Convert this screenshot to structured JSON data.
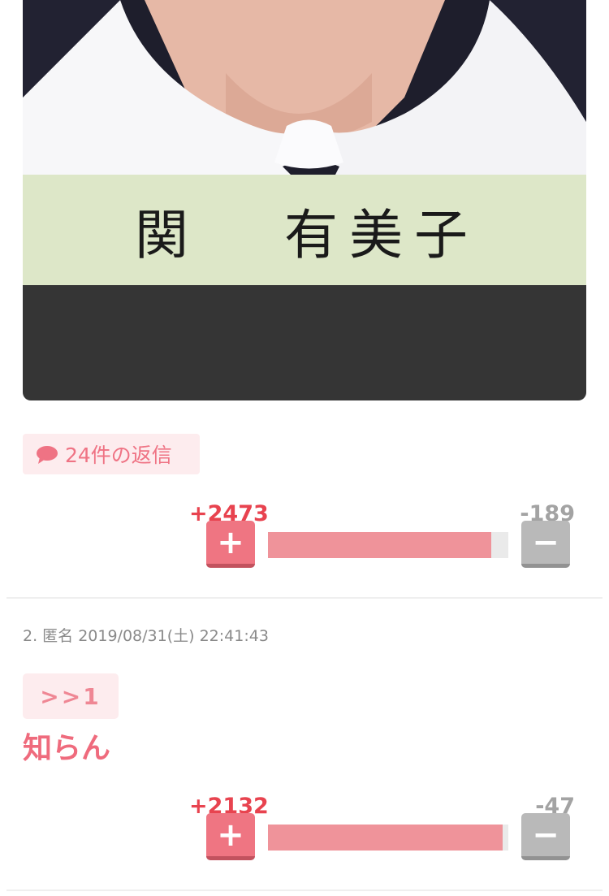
{
  "image": {
    "nameplate_surname": "関",
    "nameplate_given": "有美子"
  },
  "reply_badge": {
    "label": "24件の返信",
    "icon": "speech-bubble-icon"
  },
  "post1_votes": {
    "plus": "+2473",
    "minus": "-189",
    "plus_button": "+",
    "minus_button": "−",
    "ratio": 0.929
  },
  "post2": {
    "meta": "2. 匿名 2019/08/31(土) 22:41:43",
    "anchor": ">>1",
    "text": "知らん",
    "votes": {
      "plus": "+2132",
      "minus": "-47",
      "plus_button": "+",
      "minus_button": "−",
      "ratio": 0.978
    }
  },
  "colors": {
    "accent_pink": "#ef7384",
    "plus_red": "#e8434f",
    "minus_gray": "#a3a3a3",
    "bar_fill": "#ef939a"
  }
}
